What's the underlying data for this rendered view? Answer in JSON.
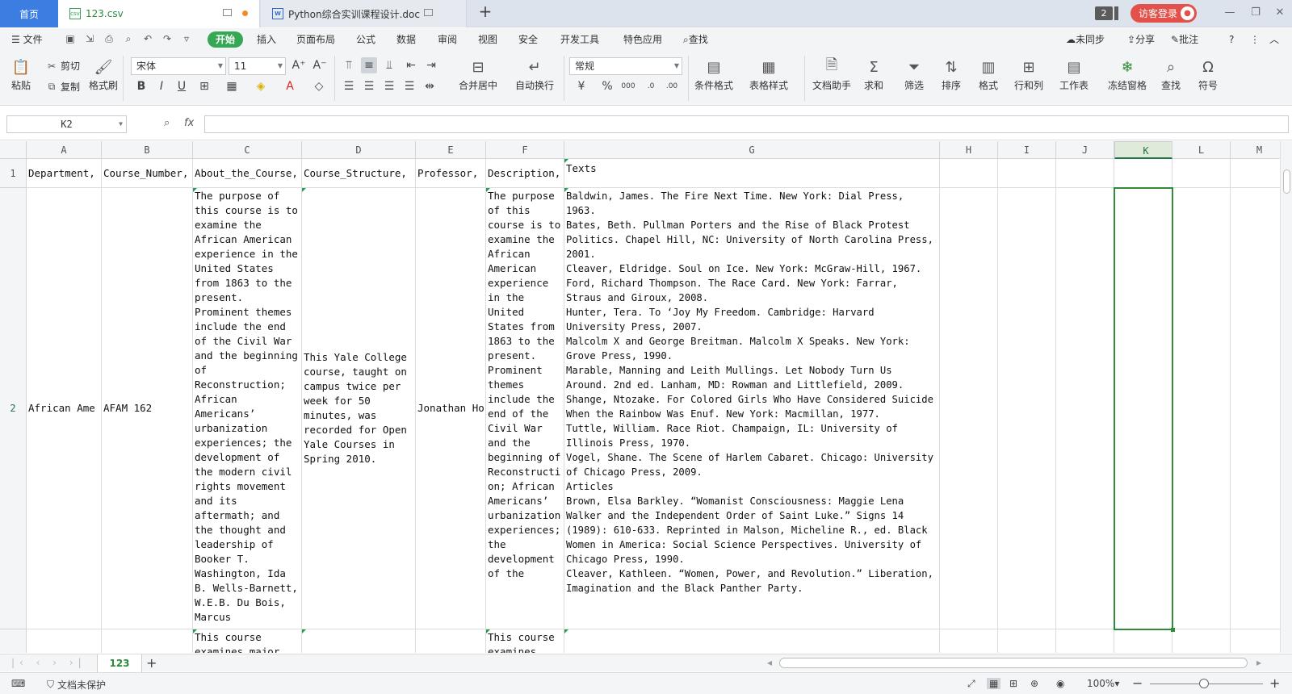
{
  "tabs": {
    "home": "首页",
    "csv": "123.csv",
    "doc": "Python综合实训课程设计.doc",
    "window_count": "2",
    "login": "访客登录"
  },
  "menu": {
    "file": "文件",
    "items": [
      "开始",
      "插入",
      "页面布局",
      "公式",
      "数据",
      "审阅",
      "视图",
      "安全",
      "开发工具",
      "特色应用"
    ],
    "search": "查找",
    "sync": "未同步",
    "share": "分享",
    "comment": "批注"
  },
  "ribbon": {
    "paste": "粘贴",
    "cut": "剪切",
    "copy": "复制",
    "format_painter": "格式刷",
    "font_name": "宋体",
    "font_size": "11",
    "merge_center": "合并居中",
    "wrap_text": "自动换行",
    "number_format": "常规",
    "cond_format": "条件格式",
    "table_style": "表格样式",
    "doc_helper": "文档助手",
    "sum": "求和",
    "filter": "筛选",
    "sort": "排序",
    "format": "格式",
    "row_col": "行和列",
    "worksheet": "工作表",
    "freeze": "冻结窗格",
    "find": "查找",
    "symbol": "符号"
  },
  "formula_bar": {
    "name_box": "K2",
    "fx": "fx",
    "value": ""
  },
  "sheet": {
    "columns": [
      "A",
      "B",
      "C",
      "D",
      "E",
      "F",
      "G",
      "H",
      "I",
      "J",
      "K",
      "L",
      "M"
    ],
    "selected_column": "K",
    "rows": [
      "1",
      "2"
    ],
    "row1": [
      "Department,",
      "Course_Number,",
      "About_the_Course,",
      "Course_Structure,",
      "Professor,",
      "Description,",
      "Texts"
    ],
    "row2": {
      "A": "African Ame",
      "B": "AFAM 162",
      "C": "The purpose of this course is to examine the African American experience in the United States from 1863 to the present. Prominent themes include the end of the Civil War and the beginning of Reconstruction; African Americans’ urbanization experiences; the development of the modern civil rights movement and its aftermath; and the thought and leadership of Booker T. Washington, Ida B. Wells-Barnett, W.E.B. Du Bois, Marcus",
      "D": "This Yale College course, taught on campus twice per week for 50 minutes, was recorded for Open Yale Courses in Spring 2010.",
      "E": "Jonathan Ho",
      "F": "The purpose of this course is to examine the African American experience in the United States from 1863 to the present. Prominent themes include the end of the Civil War and the beginning of Reconstruction; African Americans’ urbanization experiences; the development of the",
      "G": "Baldwin, James. The Fire Next Time. New York: Dial Press, 1963.\nBates, Beth. Pullman Porters and the Rise of Black Protest Politics. Chapel Hill, NC: University of North Carolina Press, 2001.\nCleaver, Eldridge. Soul on Ice. New York: McGraw-Hill, 1967.\nFord, Richard Thompson. The Race Card. New York: Farrar, Straus and Giroux, 2008.\nHunter, Tera. To ‘Joy My Freedom. Cambridge: Harvard University Press, 2007.\nMalcolm X and George Breitman. Malcolm X Speaks. New York: Grove Press, 1990.\nMarable, Manning and Leith Mullings. Let Nobody Turn Us Around. 2nd ed. Lanham, MD: Rowman and Littlefield, 2009.\nShange, Ntozake. For Colored Girls Who Have Considered Suicide When the Rainbow Was Enuf. New York: Macmillan, 1977.\nTuttle, William. Race Riot. Champaign, IL: University of Illinois Press, 1970.\nVogel, Shane. The Scene of Harlem Cabaret. Chicago: University of Chicago Press, 2009.\nArticles\nBrown, Elsa Barkley. “Womanist Consciousness: Maggie Lena Walker and the Independent Order of Saint Luke.” Signs 14 (1989): 610-633. Reprinted in Malson, Micheline R., ed. Black Women in America: Social Science Perspectives. University of Chicago Press, 1990.\nCleaver, Kathleen. “Women, Power, and Revolution.” Liberation, Imagination and the Black Panther Party."
    },
    "row3": {
      "C": "This course examines major",
      "F": "This course examines"
    },
    "sheet_tab": "123"
  },
  "status": {
    "protect": "文档未保护",
    "zoom": "100%"
  },
  "colors": {
    "accent_green": "#34a853",
    "selection": "#2e8b3a",
    "home_tab": "#3b7de0",
    "login": "#e3514b"
  }
}
